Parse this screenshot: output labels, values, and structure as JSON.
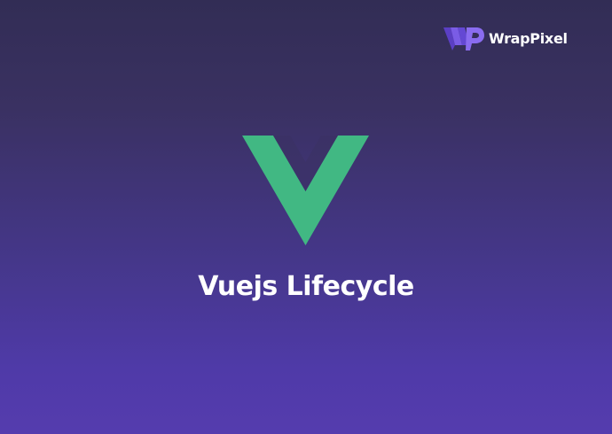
{
  "brand": {
    "name": "WrapPixel",
    "logo_icon": "wrappixel-logo-icon",
    "logo_color": "#6b4fd8"
  },
  "hero": {
    "logo_icon": "vuejs-logo-icon",
    "logo_color": "#41b883",
    "title": "Vuejs Lifecycle"
  },
  "colors": {
    "background_top": "#322d55",
    "background_bottom": "#553cae",
    "text": "#ffffff"
  }
}
